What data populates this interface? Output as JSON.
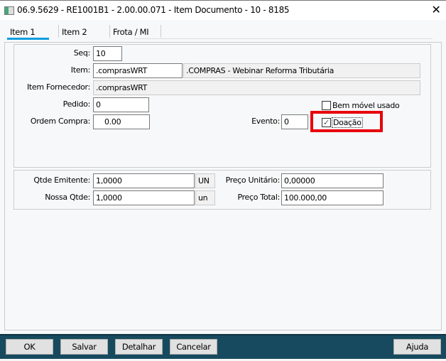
{
  "window": {
    "title": "06.9.5629 - RE1001B1 - 2.00.00.071 - Item Documento - 10 - 8185"
  },
  "tabs": [
    {
      "label": "Item 1",
      "active": true
    },
    {
      "label": "Item 2"
    },
    {
      "label": "Frota / MI"
    }
  ],
  "form": {
    "seq": {
      "label": "Seq:",
      "value": "10"
    },
    "item": {
      "label": "Item:",
      "value": ".comprasWRT",
      "description": ".COMPRAS - Webinar Reforma Tributária"
    },
    "item_fornecedor": {
      "label": "Item Fornecedor:",
      "value": ".comprasWRT"
    },
    "pedido": {
      "label": "Pedido:",
      "value": "0"
    },
    "ordem_compra": {
      "label": "Ordem Compra:",
      "value": "0.00"
    },
    "evento": {
      "label": "Evento:",
      "value": "0"
    },
    "bem_movel_usado": {
      "label": "Bem móvel usado",
      "checked": false
    },
    "doacao": {
      "label": "Doação",
      "checked": true,
      "check_glyph": "✓"
    }
  },
  "quantities": {
    "qtde_emitente": {
      "label": "Qtde Emitente:",
      "value": "1,0000",
      "unit": "UN"
    },
    "nossa_qtde": {
      "label": "Nossa Qtde:",
      "value": "1,0000",
      "unit": "un"
    },
    "preco_unitario": {
      "label": "Preço Unitário:",
      "value": "0,00000"
    },
    "preco_total": {
      "label": "Preço Total:",
      "value": "100.000,00"
    }
  },
  "buttons": {
    "ok": "OK",
    "salvar": "Salvar",
    "detalhar": "Detalhar",
    "cancelar": "Cancelar",
    "ajuda": "Ajuda"
  },
  "colors": {
    "footer": "#174a5e",
    "tab_accent": "#0a9de0",
    "highlight": "#e8000b"
  }
}
